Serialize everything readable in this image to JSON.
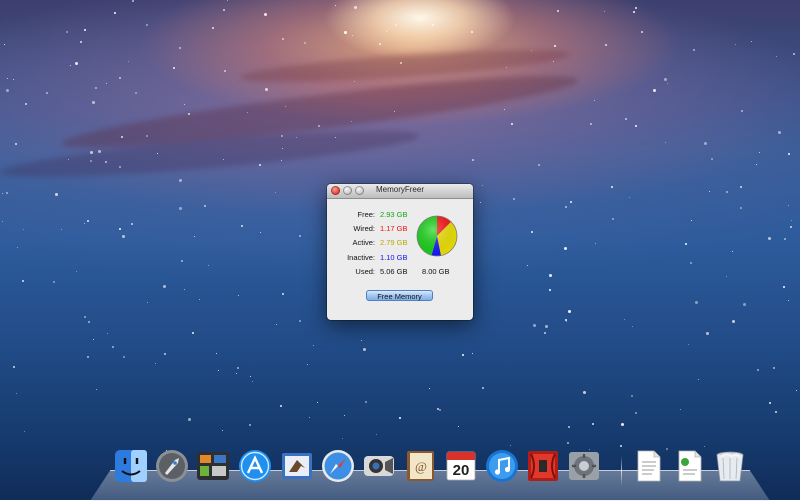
{
  "window": {
    "title": "MemoryFreer",
    "stats": [
      {
        "label": "Free:",
        "value": "2.93 GB",
        "color": "#11a811"
      },
      {
        "label": "Wired:",
        "value": "1.17 GB",
        "color": "#e8140f"
      },
      {
        "label": "Active:",
        "value": "2.79 GB",
        "color": "#b8a800"
      },
      {
        "label": "Inactive:",
        "value": "1.10 GB",
        "color": "#1212e6"
      },
      {
        "label": "Used:",
        "value": "5.06 GB",
        "color": "#111111"
      }
    ],
    "total": "8.00 GB",
    "free_button_label": "Free Memory",
    "pie_colors": {
      "free": "#15d615",
      "wired": "#ff1010",
      "active": "#f2e600",
      "inactive": "#1818ff"
    }
  },
  "dock": {
    "calendar_day": "20",
    "calendar_month": "JUL",
    "items": [
      "finder-icon",
      "launchpad-icon",
      "mission-control-icon",
      "app-store-icon",
      "mail-icon",
      "safari-icon",
      "facetime-icon",
      "address-book-icon",
      "calendar-icon",
      "itunes-icon",
      "photo-booth-icon",
      "system-preferences-icon",
      "document-icon",
      "document-icon",
      "trash-icon"
    ]
  }
}
